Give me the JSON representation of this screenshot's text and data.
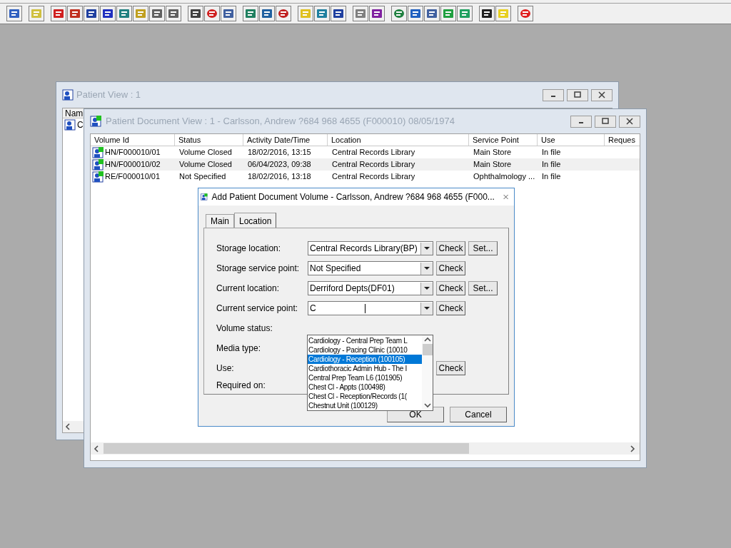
{
  "patient_view": {
    "title": "Patient View : 1",
    "columns": [
      "Nam"
    ],
    "rows": [
      "C"
    ]
  },
  "document_view": {
    "title": "Patient Document View : 1 - Carlsson, Andrew ?684 968 4655 (F000010) 08/05/1974",
    "columns": [
      "Volume Id",
      "Status",
      "Activity Date/Time",
      "Location",
      "Service Point",
      "Use",
      "Reques"
    ],
    "rows": [
      {
        "cells": [
          "HN/F000010/01",
          "Volume Closed",
          "18/02/2016, 13:15",
          "Central Records Library",
          "Main Store",
          "In file"
        ]
      },
      {
        "cells": [
          "HN/F000010/02",
          "Volume Closed",
          "06/04/2023, 09:38",
          "Central Records Library",
          "Main Store",
          "In file"
        ]
      },
      {
        "cells": [
          "RE/F000010/01",
          "Not Specified",
          "18/02/2016, 13:18",
          "Central Records Library",
          "Ophthalmology ...",
          "In file"
        ]
      }
    ]
  },
  "dialog": {
    "title": "Add Patient Document Volume - Carlsson, Andrew ?684 968 4655 (F000...",
    "tabs": [
      {
        "label": "Main",
        "selected": false
      },
      {
        "label": "Location",
        "selected": true
      }
    ],
    "fields": [
      {
        "label": "Storage location:",
        "kind": "combo",
        "value": "Central Records Library(BP)",
        "buttons": [
          "Check",
          "Set..."
        ]
      },
      {
        "label": "Storage service point:",
        "kind": "combo",
        "value": "Not Specified",
        "buttons": [
          "Check"
        ]
      },
      {
        "label": "Current location:",
        "kind": "combo",
        "value": "Derriford Depts(DF01)",
        "buttons": [
          "Check",
          "Set..."
        ]
      },
      {
        "label": "Current service point:",
        "kind": "combo",
        "value": "C",
        "buttons": [
          "Check"
        ]
      },
      {
        "label": "Volume status:",
        "kind": "covered"
      },
      {
        "label": "Media type:",
        "kind": "covered"
      },
      {
        "label": "Use:",
        "kind": "covered",
        "buttons": [
          "Check"
        ]
      },
      {
        "label": "Required on:",
        "kind": "covered"
      }
    ],
    "dropdown": {
      "items": [
        {
          "label": "Cardiology - Central Prep Team L",
          "selected": false
        },
        {
          "label": "Cardiology - Pacing Clinic (10010",
          "selected": false
        },
        {
          "label": "Cardiology - Reception (100105)",
          "selected": true
        },
        {
          "label": "Cardiothoracic Admin Hub - The I",
          "selected": false
        },
        {
          "label": "Central Prep Team L6 (101905)",
          "selected": false
        },
        {
          "label": "Chest Cl - Appts (100498)",
          "selected": false
        },
        {
          "label": "Chest Cl - Reception/Records (1(",
          "selected": false
        },
        {
          "label": "Chestnut Unit (100129)",
          "selected": false
        }
      ]
    },
    "buttons": [
      "OK",
      "Cancel"
    ]
  }
}
